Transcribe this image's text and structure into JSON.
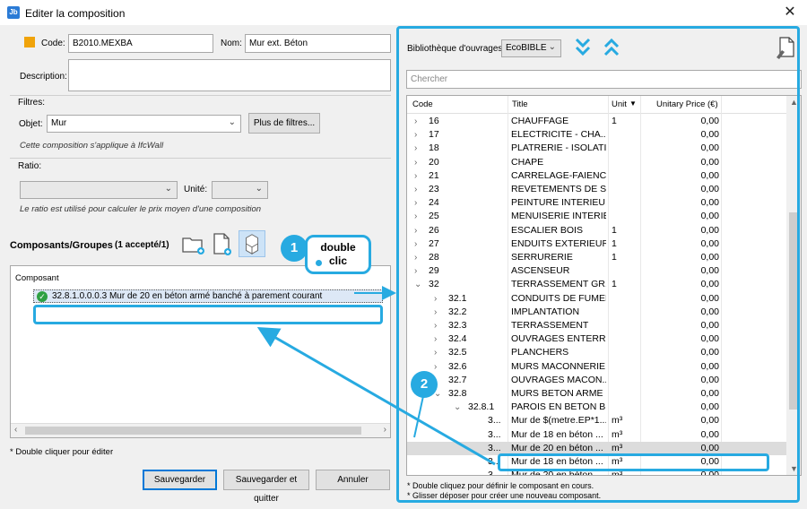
{
  "window": {
    "title": "Editer la composition",
    "app_icon_text": "Jb"
  },
  "form": {
    "code_label": "Code:",
    "code_value": "B2010.MEXBA",
    "nom_label": "Nom:",
    "nom_value": "Mur ext. Béton",
    "description_label": "Description:",
    "description_value": "",
    "filtres_label": "Filtres:",
    "objet_label": "Objet:",
    "objet_value": "Mur",
    "more_filters_button": "Plus de filtres...",
    "filter_note": "Cette composition s'applique à IfcWall",
    "ratio_label": "Ratio:",
    "ratio_value": "",
    "unite_label": "Unité:",
    "unite_value": "",
    "ratio_note": "Le ratio est utilisé pour calculer le prix moyen d'une composition",
    "code_color": "#f0a30a"
  },
  "components": {
    "title": "Composants/Groupes",
    "count": "(1 accepté/1)",
    "column_header": "Composant",
    "rows": [
      "32.8.1.0.0.0.3 Mur de 20 en béton armé banché à parement courant"
    ],
    "footer_note": "* Double cliquer pour éditer"
  },
  "buttons": {
    "save": "Sauvegarder",
    "save_quit": "Sauvegarder et quitter",
    "cancel": "Annuler"
  },
  "library": {
    "label": "Bibliothèque d'ouvrages:",
    "selected": "EcoBIBLE",
    "search_placeholder": "Chercher",
    "columns": {
      "code": "Code",
      "title": "Title",
      "unit": "Unit",
      "price": "Unitary Price (€)"
    },
    "rows": [
      {
        "arrow": "›",
        "code": "16",
        "title": "CHAUFFAGE",
        "unit": "1",
        "price": "0,00"
      },
      {
        "arrow": "›",
        "code": "17",
        "title": "ELECTRICITE - CHA...",
        "unit": "",
        "price": "0,00"
      },
      {
        "arrow": "›",
        "code": "18",
        "title": "PLATRERIE - ISOLATI...",
        "unit": "",
        "price": "0,00"
      },
      {
        "arrow": "›",
        "code": "20",
        "title": "CHAPE",
        "unit": "",
        "price": "0,00"
      },
      {
        "arrow": "›",
        "code": "21",
        "title": "CARRELAGE-FAIENCE",
        "unit": "",
        "price": "0,00"
      },
      {
        "arrow": "›",
        "code": "23",
        "title": "REVETEMENTS DE S...",
        "unit": "",
        "price": "0,00"
      },
      {
        "arrow": "›",
        "code": "24",
        "title": "PEINTURE INTERIEU...",
        "unit": "",
        "price": "0,00"
      },
      {
        "arrow": "›",
        "code": "25",
        "title": "MENUISERIE INTERIE...",
        "unit": "",
        "price": "0,00"
      },
      {
        "arrow": "›",
        "code": "26",
        "title": "ESCALIER BOIS",
        "unit": "1",
        "price": "0,00"
      },
      {
        "arrow": "›",
        "code": "27",
        "title": "ENDUITS EXTERIEURS",
        "unit": "1",
        "price": "0,00"
      },
      {
        "arrow": "›",
        "code": "28",
        "title": "SERRURERIE",
        "unit": "1",
        "price": "0,00"
      },
      {
        "arrow": "›",
        "code": "29",
        "title": "ASCENSEUR",
        "unit": "",
        "price": "0,00"
      },
      {
        "arrow": "⌄",
        "code": "32",
        "title": "TERRASSEMENT GR...",
        "unit": "1",
        "price": "0,00"
      },
      {
        "arrow": "›",
        "code": "32.1",
        "title": "CONDUITS DE FUMEE",
        "unit": "",
        "price": "0,00"
      },
      {
        "arrow": "›",
        "code": "32.2",
        "title": "IMPLANTATION",
        "unit": "",
        "price": "0,00"
      },
      {
        "arrow": "›",
        "code": "32.3",
        "title": "TERRASSEMENT",
        "unit": "",
        "price": "0,00"
      },
      {
        "arrow": "›",
        "code": "32.4",
        "title": "OUVRAGES ENTERRES",
        "unit": "",
        "price": "0,00"
      },
      {
        "arrow": "›",
        "code": "32.5",
        "title": "PLANCHERS",
        "unit": "",
        "price": "0,00"
      },
      {
        "arrow": "›",
        "code": "32.6",
        "title": "MURS MACONNERIE",
        "unit": "",
        "price": "0,00"
      },
      {
        "arrow": "›",
        "code": "32.7",
        "title": "OUVRAGES MACON...",
        "unit": "",
        "price": "0,00"
      },
      {
        "arrow": "⌄",
        "code": "32.8",
        "title": "MURS BETON ARME",
        "unit": "",
        "price": "0,00"
      },
      {
        "arrow": "⌄",
        "code": "32.8.1",
        "title": "PAROIS EN BETON B...",
        "unit": "",
        "price": "0,00"
      },
      {
        "arrow": "",
        "code": "3...",
        "title": "Mur de $(metre.EP*1...",
        "unit": "m³",
        "price": "0,00"
      },
      {
        "arrow": "",
        "code": "3...",
        "title": "Mur de 18 en béton ...",
        "unit": "m³",
        "price": "0,00"
      },
      {
        "arrow": "",
        "code": "3...",
        "title": "Mur de 20 en béton ...",
        "unit": "m³",
        "price": "0,00"
      },
      {
        "arrow": "",
        "code": "3...",
        "title": "Mur de 18 en béton ...",
        "unit": "m³",
        "price": "0,00"
      },
      {
        "arrow": "",
        "code": "3...",
        "title": "Mur de 20 en béton ...",
        "unit": "m³",
        "price": "0,00"
      }
    ],
    "highlighted_row": 24,
    "notes": [
      "* Double cliquez pour définir le composant en cours.",
      "* Glisser déposer pour créer une nouveau composant."
    ]
  },
  "annotations": {
    "badge1": "1",
    "badge2": "2",
    "bubble_line1": "double",
    "bubble_line2": "clic",
    "accent": "#27aae1"
  }
}
